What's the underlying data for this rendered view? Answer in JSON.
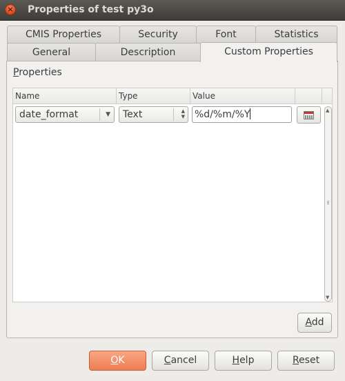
{
  "window": {
    "title": "Properties of test py3o",
    "close_symbol": "×"
  },
  "tabs": {
    "row1": [
      "CMIS Properties",
      "Security",
      "Font",
      "Statistics"
    ],
    "row2": [
      "General",
      "Description",
      "Custom Properties"
    ],
    "active": "Custom Properties"
  },
  "properties": {
    "label_mnemonic": "P",
    "label_rest": "roperties",
    "columns": {
      "name": "Name",
      "type": "Type",
      "value": "Value"
    },
    "rows": [
      {
        "name": "date_format",
        "type": "Text",
        "value": "%d/%m/%Y"
      }
    ]
  },
  "buttons": {
    "add": {
      "mnemonic": "A",
      "rest": "dd"
    },
    "ok": {
      "mnemonic": "O",
      "rest": "K"
    },
    "cancel": {
      "mnemonic": "C",
      "rest": "ancel"
    },
    "help": {
      "mnemonic": "H",
      "rest": "elp"
    },
    "reset": {
      "mnemonic": "R",
      "rest": "eset"
    }
  },
  "colors": {
    "accent": "#ee7c52",
    "titlebar": "#3e3d39",
    "close": "#d9471c"
  }
}
